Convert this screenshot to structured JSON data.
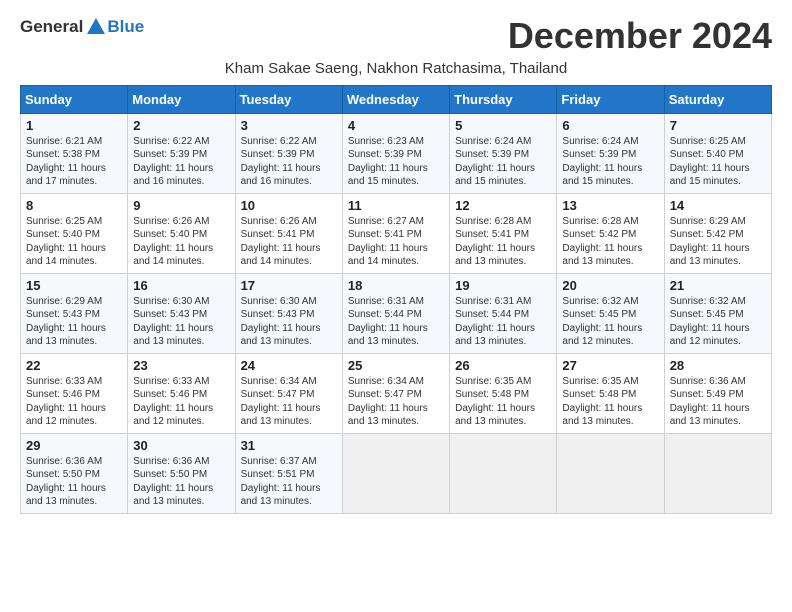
{
  "header": {
    "logo_general": "General",
    "logo_blue": "Blue",
    "month_title": "December 2024",
    "subtitle": "Kham Sakae Saeng, Nakhon Ratchasima, Thailand"
  },
  "days_of_week": [
    "Sunday",
    "Monday",
    "Tuesday",
    "Wednesday",
    "Thursday",
    "Friday",
    "Saturday"
  ],
  "weeks": [
    [
      {
        "day": "1",
        "sunrise": "6:21 AM",
        "sunset": "5:38 PM",
        "daylight": "11 hours and 17 minutes."
      },
      {
        "day": "2",
        "sunrise": "6:22 AM",
        "sunset": "5:39 PM",
        "daylight": "11 hours and 16 minutes."
      },
      {
        "day": "3",
        "sunrise": "6:22 AM",
        "sunset": "5:39 PM",
        "daylight": "11 hours and 16 minutes."
      },
      {
        "day": "4",
        "sunrise": "6:23 AM",
        "sunset": "5:39 PM",
        "daylight": "11 hours and 15 minutes."
      },
      {
        "day": "5",
        "sunrise": "6:24 AM",
        "sunset": "5:39 PM",
        "daylight": "11 hours and 15 minutes."
      },
      {
        "day": "6",
        "sunrise": "6:24 AM",
        "sunset": "5:39 PM",
        "daylight": "11 hours and 15 minutes."
      },
      {
        "day": "7",
        "sunrise": "6:25 AM",
        "sunset": "5:40 PM",
        "daylight": "11 hours and 15 minutes."
      }
    ],
    [
      {
        "day": "8",
        "sunrise": "6:25 AM",
        "sunset": "5:40 PM",
        "daylight": "11 hours and 14 minutes."
      },
      {
        "day": "9",
        "sunrise": "6:26 AM",
        "sunset": "5:40 PM",
        "daylight": "11 hours and 14 minutes."
      },
      {
        "day": "10",
        "sunrise": "6:26 AM",
        "sunset": "5:41 PM",
        "daylight": "11 hours and 14 minutes."
      },
      {
        "day": "11",
        "sunrise": "6:27 AM",
        "sunset": "5:41 PM",
        "daylight": "11 hours and 14 minutes."
      },
      {
        "day": "12",
        "sunrise": "6:28 AM",
        "sunset": "5:41 PM",
        "daylight": "11 hours and 13 minutes."
      },
      {
        "day": "13",
        "sunrise": "6:28 AM",
        "sunset": "5:42 PM",
        "daylight": "11 hours and 13 minutes."
      },
      {
        "day": "14",
        "sunrise": "6:29 AM",
        "sunset": "5:42 PM",
        "daylight": "11 hours and 13 minutes."
      }
    ],
    [
      {
        "day": "15",
        "sunrise": "6:29 AM",
        "sunset": "5:43 PM",
        "daylight": "11 hours and 13 minutes."
      },
      {
        "day": "16",
        "sunrise": "6:30 AM",
        "sunset": "5:43 PM",
        "daylight": "11 hours and 13 minutes."
      },
      {
        "day": "17",
        "sunrise": "6:30 AM",
        "sunset": "5:43 PM",
        "daylight": "11 hours and 13 minutes."
      },
      {
        "day": "18",
        "sunrise": "6:31 AM",
        "sunset": "5:44 PM",
        "daylight": "11 hours and 13 minutes."
      },
      {
        "day": "19",
        "sunrise": "6:31 AM",
        "sunset": "5:44 PM",
        "daylight": "11 hours and 13 minutes."
      },
      {
        "day": "20",
        "sunrise": "6:32 AM",
        "sunset": "5:45 PM",
        "daylight": "11 hours and 12 minutes."
      },
      {
        "day": "21",
        "sunrise": "6:32 AM",
        "sunset": "5:45 PM",
        "daylight": "11 hours and 12 minutes."
      }
    ],
    [
      {
        "day": "22",
        "sunrise": "6:33 AM",
        "sunset": "5:46 PM",
        "daylight": "11 hours and 12 minutes."
      },
      {
        "day": "23",
        "sunrise": "6:33 AM",
        "sunset": "5:46 PM",
        "daylight": "11 hours and 12 minutes."
      },
      {
        "day": "24",
        "sunrise": "6:34 AM",
        "sunset": "5:47 PM",
        "daylight": "11 hours and 13 minutes."
      },
      {
        "day": "25",
        "sunrise": "6:34 AM",
        "sunset": "5:47 PM",
        "daylight": "11 hours and 13 minutes."
      },
      {
        "day": "26",
        "sunrise": "6:35 AM",
        "sunset": "5:48 PM",
        "daylight": "11 hours and 13 minutes."
      },
      {
        "day": "27",
        "sunrise": "6:35 AM",
        "sunset": "5:48 PM",
        "daylight": "11 hours and 13 minutes."
      },
      {
        "day": "28",
        "sunrise": "6:36 AM",
        "sunset": "5:49 PM",
        "daylight": "11 hours and 13 minutes."
      }
    ],
    [
      {
        "day": "29",
        "sunrise": "6:36 AM",
        "sunset": "5:50 PM",
        "daylight": "11 hours and 13 minutes."
      },
      {
        "day": "30",
        "sunrise": "6:36 AM",
        "sunset": "5:50 PM",
        "daylight": "11 hours and 13 minutes."
      },
      {
        "day": "31",
        "sunrise": "6:37 AM",
        "sunset": "5:51 PM",
        "daylight": "11 hours and 13 minutes."
      },
      null,
      null,
      null,
      null
    ]
  ]
}
